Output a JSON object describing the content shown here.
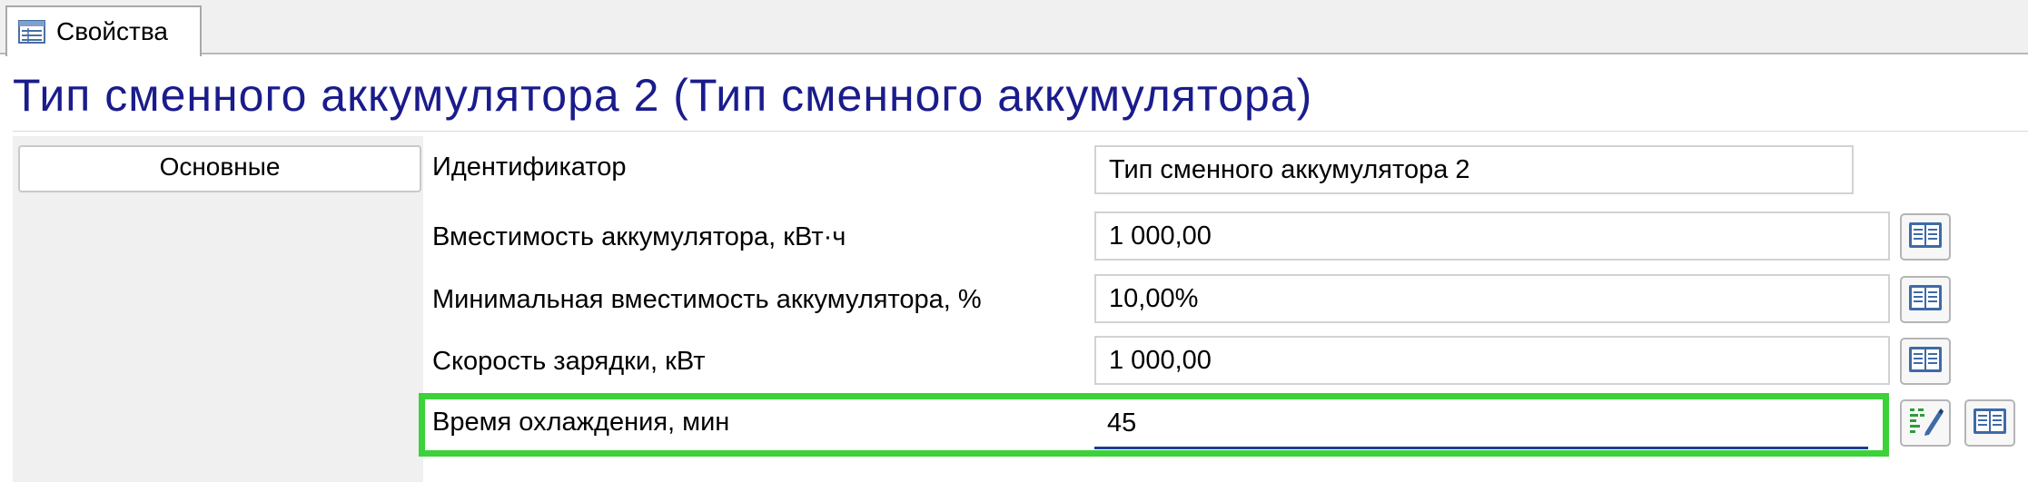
{
  "tab": {
    "label": "Свойства",
    "icon": "properties-grid-icon"
  },
  "page": {
    "title": "Тип сменного аккумулятора 2 (Тип сменного аккумулятора)"
  },
  "sections": [
    {
      "label": "Основные"
    }
  ],
  "properties": [
    {
      "label": "Идентификатор",
      "value": "Тип сменного аккумулятора 2"
    },
    {
      "label": "Вместимость аккумулятора, кВт·ч",
      "value": "1 000,00"
    },
    {
      "label": "Минимальная вместимость аккумулятора, %",
      "value": "10,00%"
    },
    {
      "label": "Скорость зарядки, кВт",
      "value": "1 000,00"
    },
    {
      "label": "Время охлаждения, мин",
      "value": "45"
    }
  ],
  "colors": {
    "title": "#1a1c8c",
    "highlight": "#3dd13a",
    "active_underline": "#1d3b9a"
  }
}
